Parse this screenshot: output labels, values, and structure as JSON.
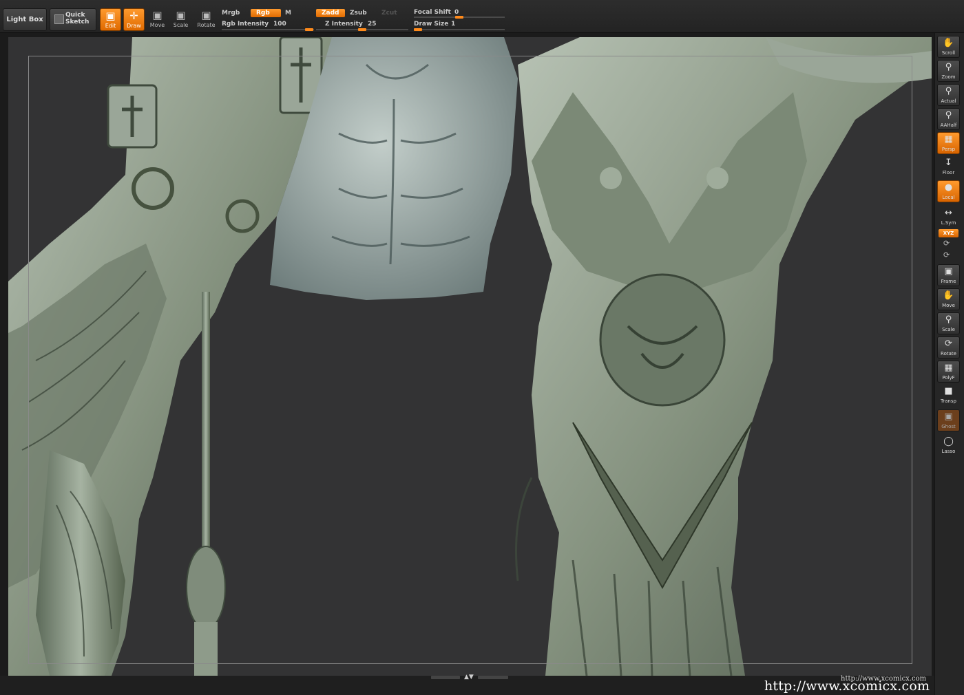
{
  "toolbar": {
    "light_box": "Light Box",
    "quick_sketch_line1": "Quick",
    "quick_sketch_line2": "Sketch",
    "edit": "Edit",
    "draw": "Draw",
    "move": "Move",
    "scale": "Scale",
    "rotate": "Rotate",
    "mrgb": "Mrgb",
    "rgb": "Rgb",
    "m": "M",
    "rgb_intensity_label": "Rgb Intensity",
    "rgb_intensity_value": "100",
    "zadd": "Zadd",
    "zsub": "Zsub",
    "zcut": "Zcut",
    "z_intensity_label": "Z Intensity",
    "z_intensity_value": "25",
    "focal_shift_label": "Focal Shift",
    "focal_shift_value": "0",
    "draw_size_label": "Draw Size",
    "draw_size_value": "1",
    "accent_color": "#ff8a1a"
  },
  "right_tray": {
    "scroll": "Scroll",
    "zoom": "Zoom",
    "actual": "Actual",
    "aahalf": "AAHalf",
    "persp": "Persp",
    "floor": "Floor",
    "local": "Local",
    "lsym": "L.Sym",
    "xyz": "XYZ",
    "frame": "Frame",
    "move": "Move",
    "scale": "Scale",
    "rotate": "Rotate",
    "polyf": "PolyF",
    "transp": "Transp",
    "ghost": "Ghost",
    "lasso": "Lasso"
  },
  "viewport": {
    "background_color": "#333334",
    "model_color": "#8e9b8a"
  },
  "watermark": {
    "small": "http://www.xcomicx.com",
    "large": "http://www.xcomicx.com"
  }
}
